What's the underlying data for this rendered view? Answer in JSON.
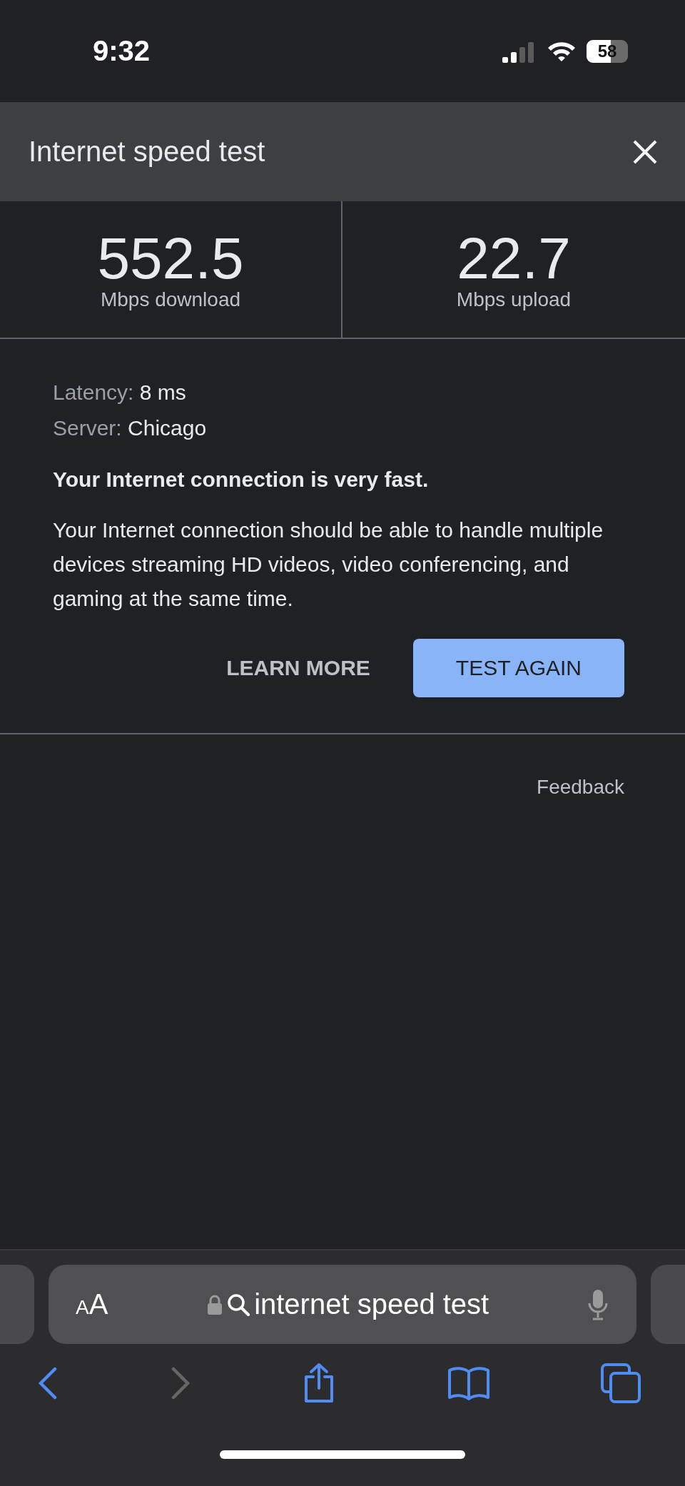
{
  "status_bar": {
    "time": "9:32",
    "battery": {
      "label": "58",
      "level": 0.58
    }
  },
  "header": {
    "title": "Internet speed test"
  },
  "results": [
    {
      "value": "552.5",
      "unit": "Mbps download"
    },
    {
      "value": "22.7",
      "unit": "Mbps upload"
    }
  ],
  "details": [
    {
      "label": "Latency:",
      "value": "8 ms"
    },
    {
      "label": "Server:",
      "value": "Chicago"
    }
  ],
  "summary": "Your Internet connection is very fast.",
  "description": "Your Internet connection should be able to handle multiple devices streaming HD videos, video conferencing, and gaming at the same time.",
  "buttons": [
    {
      "label": "LEARN MORE",
      "kind": "text"
    },
    {
      "label": "TEST AGAIN",
      "kind": "filled"
    }
  ],
  "feedback": "Feedback",
  "browser": {
    "reader_button": "AA",
    "address": "internet speed test",
    "back_disabled": false,
    "forward_disabled": true
  }
}
